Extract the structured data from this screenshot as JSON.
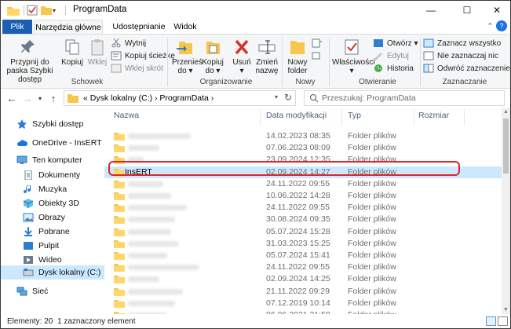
{
  "window": {
    "title": "ProgramData",
    "controls": {
      "minimize": "—",
      "maximize": "☐",
      "close": "✕"
    }
  },
  "ribbon_tabs": [
    "Plik",
    "Narzędzia główne",
    "Udostępnianie",
    "Widok"
  ],
  "ribbon": {
    "clipboard": {
      "pin": "Przypnij do paska Szybki dostęp",
      "copy": "Kopiuj",
      "paste": "Wklej",
      "cut": "Wytnij",
      "copy_path": "Kopiuj ścieżkę",
      "paste_shortcut": "Wklej skrót",
      "label": "Schowek"
    },
    "organize": {
      "move_to": "Przenieś do ▾",
      "copy_to": "Kopiuj do ▾",
      "delete": "Usuń ▾",
      "rename": "Zmień nazwę",
      "label": "Organizowanie"
    },
    "new": {
      "new_folder": "Nowy folder",
      "label": "Nowy"
    },
    "open": {
      "properties": "Właściwości ▾",
      "open": "Otwórz ▾",
      "edit": "Edytuj",
      "history": "Historia",
      "label": "Otwieranie"
    },
    "select": {
      "select_all": "Zaznacz wszystko",
      "select_none": "Nie zaznaczaj nic",
      "invert": "Odwróć zaznaczenie",
      "label": "Zaznaczanie"
    }
  },
  "address": {
    "crumbs": "«  Dysk lokalny (C:)  ›  ProgramData  ›",
    "search_placeholder": "Przeszukaj: ProgramData"
  },
  "nav_pane": [
    {
      "label": "Szybki dostęp",
      "icon": "star-icon"
    },
    {
      "label": "OneDrive - InsERT",
      "icon": "cloud-icon"
    },
    {
      "label": "Ten komputer",
      "icon": "computer-icon"
    },
    {
      "label": "Dokumenty",
      "icon": "document-icon"
    },
    {
      "label": "Muzyka",
      "icon": "music-icon"
    },
    {
      "label": "Obiekty 3D",
      "icon": "cube-icon"
    },
    {
      "label": "Obrazy",
      "icon": "image-icon"
    },
    {
      "label": "Pobrane",
      "icon": "download-icon"
    },
    {
      "label": "Pulpit",
      "icon": "desktop-icon"
    },
    {
      "label": "Wideo",
      "icon": "video-icon"
    },
    {
      "label": "Dysk lokalny (C:)",
      "icon": "drive-icon"
    },
    {
      "label": "Sieć",
      "icon": "network-icon"
    }
  ],
  "columns": {
    "name": "Nazwa",
    "date": "Data modyfikacji",
    "type": "Typ",
    "size": "Rozmiar"
  },
  "files": [
    {
      "name": "",
      "date": "14.02.2023 08:35",
      "type": "Folder plików",
      "blur_w": 80
    },
    {
      "name": "",
      "date": "07.06.2023 08:09",
      "type": "Folder plików",
      "blur_w": 40
    },
    {
      "name": "",
      "date": "23.09.2024 12:35",
      "type": "Folder plików",
      "blur_w": 20
    },
    {
      "name": "InsERT",
      "date": "02.09.2024 14:27",
      "type": "Folder plików",
      "selected": true
    },
    {
      "name": "",
      "date": "24.11.2022 09:55",
      "type": "Folder plików",
      "blur_w": 45
    },
    {
      "name": "",
      "date": "10.06.2022 14:28",
      "type": "Folder plików",
      "blur_w": 55
    },
    {
      "name": "",
      "date": "24.11.2022 09:55",
      "type": "Folder plików",
      "blur_w": 75
    },
    {
      "name": "",
      "date": "30.08.2024 09:35",
      "type": "Folder plików",
      "blur_w": 60
    },
    {
      "name": "",
      "date": "05.07.2024 15:28",
      "type": "Folder plików",
      "blur_w": 55
    },
    {
      "name": "",
      "date": "31.03.2023 15:25",
      "type": "Folder plików",
      "blur_w": 65
    },
    {
      "name": "",
      "date": "05.07.2024 15:41",
      "type": "Folder plików",
      "blur_w": 50
    },
    {
      "name": "",
      "date": "24.11.2022 09:55",
      "type": "Folder plików",
      "blur_w": 90
    },
    {
      "name": "",
      "date": "02.09.2024 14:25",
      "type": "Folder plików",
      "blur_w": 40
    },
    {
      "name": "",
      "date": "21.11.2022 09:29",
      "type": "Folder plików",
      "blur_w": 70
    },
    {
      "name": "",
      "date": "07.12.2019 10:14",
      "type": "Folder plików",
      "blur_w": 60
    },
    {
      "name": "",
      "date": "06.06.2021 21:59",
      "type": "Folder plików",
      "blur_w": 50
    }
  ],
  "status": {
    "count": "Elementy: 20",
    "selection": "1 zaznaczony element"
  },
  "colors": {
    "accent": "#1a5fb4",
    "selection": "#cce8ff",
    "highlight_border": "#e0262b",
    "folder": "#f7c64a"
  }
}
